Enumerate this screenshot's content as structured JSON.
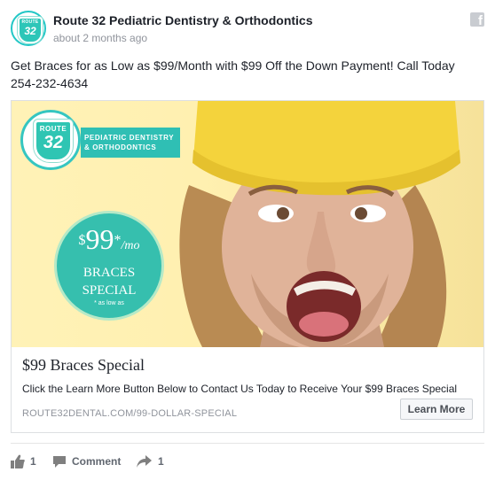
{
  "post": {
    "page_name": "Route 32 Pediatric Dentistry & Orthodontics",
    "timestamp": "about 2 months ago",
    "text": "Get Braces for as Low as $99/Month with $99 Off the Down Payment! Call Today 254-232-4634"
  },
  "avatar": {
    "line1": "ROUTE",
    "line2": "32"
  },
  "ad": {
    "logo": {
      "line1": "ROUTE",
      "line2": "32"
    },
    "ribbon": {
      "line1": "PEDIATRIC DENTISTRY",
      "line2": "& ORTHODONTICS"
    },
    "badge": {
      "currency": "$",
      "amount": "99",
      "asterisk": "*",
      "unit": "/mo",
      "line1": "BRACES",
      "line2": "SPECIAL",
      "small": "* as low as"
    },
    "headline": "$99 Braces Special",
    "description": "Click the Learn More Button Below to Contact Us Today to Receive Your $99 Braces Special",
    "domain": "ROUTE32DENTAL.COM/99-DOLLAR-SPECIAL",
    "cta": "Learn More"
  },
  "footer": {
    "like_count": "1",
    "comment_label": "Comment",
    "share_count": "1"
  },
  "icons": {
    "platform": "facebook-icon",
    "like": "thumbs-up-icon",
    "comment": "speech-bubble-icon",
    "share": "share-arrow-icon"
  },
  "colors": {
    "brand_teal": "#2fbfb4",
    "hat_yellow": "#f4d33c",
    "background_yellow": "#fff2b7"
  }
}
